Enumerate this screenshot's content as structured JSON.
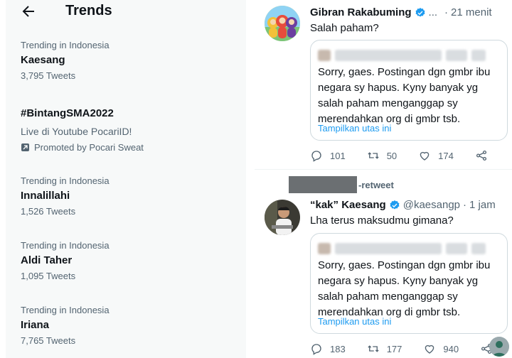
{
  "trends_panel": {
    "title": "Trends",
    "items": [
      {
        "context": "Trending in Indonesia",
        "name": "Kaesang",
        "count": "3,795 Tweets"
      },
      {
        "context": "",
        "name": "#BintangSMA2022",
        "description": "Live di Youtube PocariID!",
        "promoted_by": "Promoted by Pocari Sweat"
      },
      {
        "context": "Trending in Indonesia",
        "name": "Innalillahi",
        "count": "1,526 Tweets"
      },
      {
        "context": "Trending in Indonesia",
        "name": "Aldi Taher",
        "count": "1,095 Tweets"
      },
      {
        "context": "Trending in Indonesia",
        "name": "Iriana",
        "count": "7,765 Tweets"
      }
    ]
  },
  "tweets": [
    {
      "display_name": "Gibran Rakabuming",
      "handle_dots": "...",
      "dot": "·",
      "time": "21 menit",
      "text": "Salah paham?",
      "quote": {
        "text": "Sorry, gaes. Postingan dgn gmbr ibu negara sy hapus. Kyny banyak yg salah paham menganggap sy merendahkan org di gmbr tsb.",
        "link": "Tampilkan utas ini"
      },
      "actions": {
        "reply": "101",
        "retweet": "50",
        "like": "174"
      }
    },
    {
      "retweet_label": "-retweet",
      "display_name": "“kak” Kaesang",
      "handle": "@kaesangp",
      "dot": "·",
      "time": "1 jam",
      "text": "Lha terus maksudmu gimana?",
      "quote": {
        "text": "Sorry, gaes. Postingan dgn gmbr ibu negara sy hapus. Kyny banyak yg salah paham menganggap sy merendahkan org di gmbr tsb.",
        "link": "Tampilkan utas ini"
      },
      "actions": {
        "reply": "183",
        "retweet": "177",
        "like": "940"
      }
    }
  ],
  "colors": {
    "accent": "#1d9bf0",
    "muted": "#536471",
    "text": "#0f1419"
  }
}
